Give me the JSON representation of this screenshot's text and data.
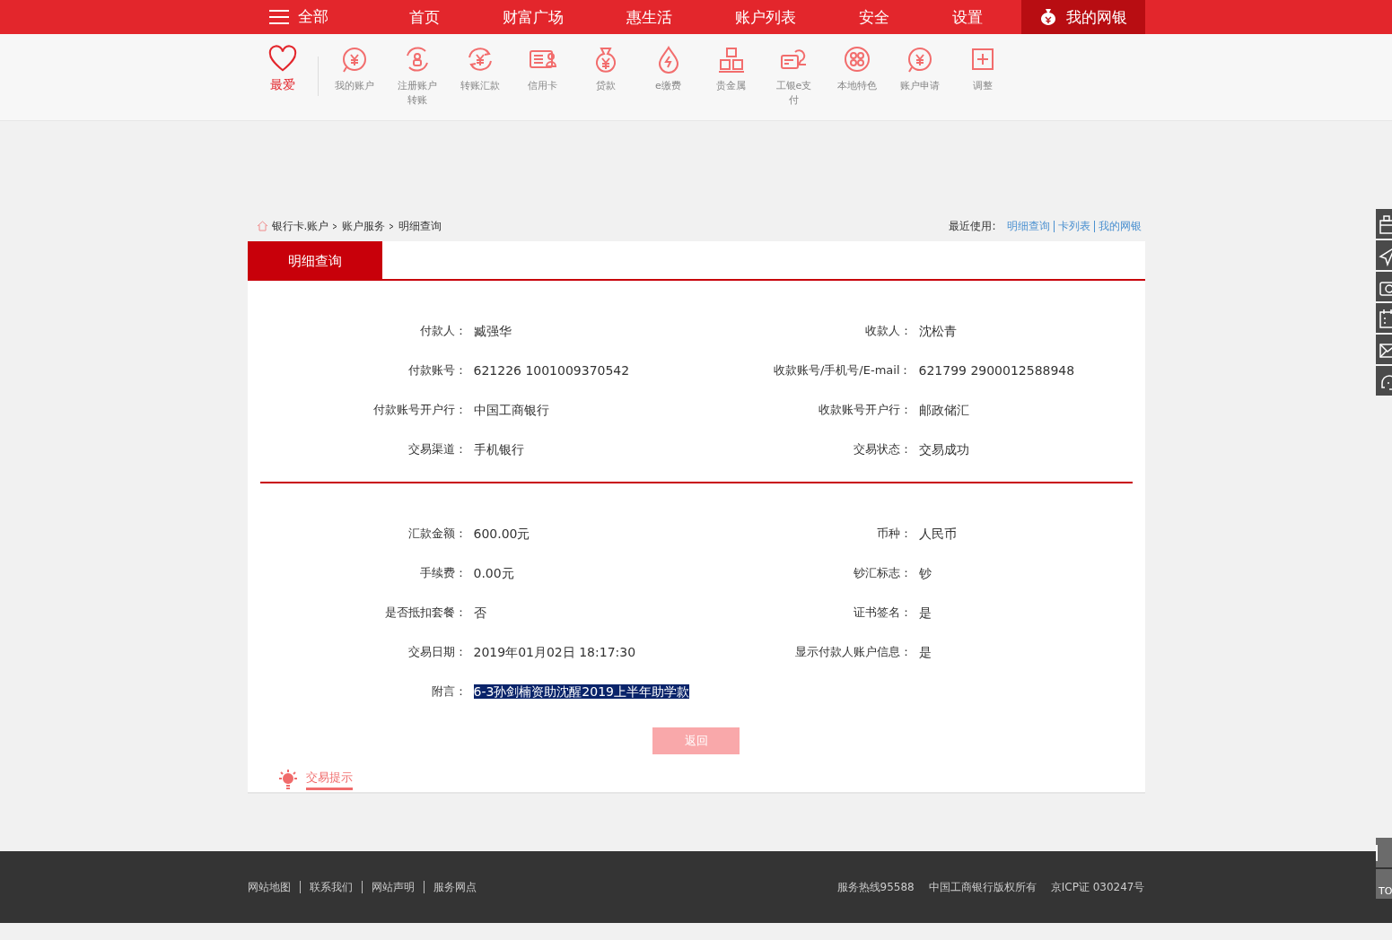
{
  "nav": {
    "menu_label": "全部",
    "items": [
      {
        "label": "首页",
        "selected": false
      },
      {
        "label": "财富广场",
        "selected": false
      },
      {
        "label": "惠生活",
        "selected": false
      },
      {
        "label": "账户列表",
        "selected": false
      },
      {
        "label": "安全",
        "selected": false
      },
      {
        "label": "设置",
        "selected": false
      },
      {
        "label": "我的网银",
        "selected": true
      }
    ]
  },
  "shortcuts": {
    "favorite": "最爱",
    "items": [
      {
        "kind": "yen",
        "label": "我的账户"
      },
      {
        "kind": "register",
        "label": "注册账户转账"
      },
      {
        "kind": "transfer",
        "label": "转账汇款"
      },
      {
        "kind": "card",
        "label": "信用卡"
      },
      {
        "kind": "bag",
        "label": "贷款"
      },
      {
        "kind": "drop",
        "label": "e缴费"
      },
      {
        "kind": "bars",
        "label": "贵金属"
      },
      {
        "kind": "pay",
        "label": "工银e支付"
      },
      {
        "kind": "dots",
        "label": "本地特色"
      },
      {
        "kind": "yen",
        "label": "账户申请"
      },
      {
        "kind": "plus",
        "label": "调整"
      }
    ]
  },
  "breadcrumb": [
    "银行卡.账户",
    "账户服务",
    "明细查询"
  ],
  "recent": {
    "label": "最近使用:",
    "links": [
      "明细查询",
      "卡列表",
      "我的网银"
    ]
  },
  "tab": "明细查询",
  "sections": [
    {
      "rows": [
        {
          "left": {
            "label": "付款人：",
            "value": "臧强华"
          },
          "right": {
            "label": "收款人：",
            "value": "沈松青"
          }
        },
        {
          "left": {
            "label": "付款账号：",
            "value": "621226 1001009370542"
          },
          "right": {
            "label": "收款账号/手机号/E-mail：",
            "value": "621799 2900012588948"
          }
        },
        {
          "left": {
            "label": "付款账号开户行：",
            "value": "中国工商银行"
          },
          "right": {
            "label": "收款账号开户行：",
            "value": "邮政储汇"
          }
        },
        {
          "left": {
            "label": "交易渠道：",
            "value": "手机银行"
          },
          "right": {
            "label": "交易状态：",
            "value": "交易成功"
          }
        }
      ]
    },
    {
      "rows": [
        {
          "left": {
            "label": "汇款金额：",
            "value": "600.00元"
          },
          "right": {
            "label": "币种：",
            "value": "人民币"
          }
        },
        {
          "left": {
            "label": "手续费：",
            "value": "0.00元"
          },
          "right": {
            "label": "钞汇标志：",
            "value": "钞"
          }
        },
        {
          "left": {
            "label": "是否抵扣套餐：",
            "value": "否"
          },
          "right": {
            "label": "证书签名：",
            "value": "是"
          }
        },
        {
          "left": {
            "label": "交易日期：",
            "value": "2019年01月02日 18:17:30"
          },
          "right": {
            "label": "显示付款人账户信息：",
            "value": "是"
          }
        },
        {
          "left": {
            "label": "附言：",
            "value": "6-3孙剑楠资助沈醒2019上半年助学款",
            "highlighted": true
          }
        }
      ]
    }
  ],
  "back_button": "返回",
  "tips_tab": "交易提示",
  "side_bottom": {
    "label": "TO"
  },
  "footer": {
    "links": [
      "网站地图",
      "联系我们",
      "网站声明",
      "服务网点"
    ],
    "info": [
      "服务热线95588",
      "中国工商银行版权所有",
      "京ICP证 030247号"
    ]
  }
}
